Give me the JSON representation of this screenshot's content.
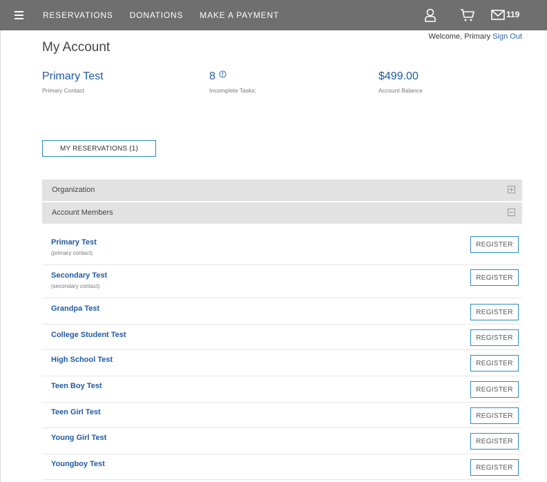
{
  "nav": {
    "items": [
      "RESERVATIONS",
      "DONATIONS",
      "MAKE A PAYMENT"
    ],
    "mail_count": "119",
    "icons": [
      "menu-icon",
      "user-icon",
      "cart-icon",
      "mail-icon"
    ]
  },
  "welcome": {
    "text": "Welcome, Primary",
    "sign_out": "Sign Out"
  },
  "page_title": "My Account",
  "stats": {
    "primary_name": "Primary Test",
    "primary_label": "Primary Contact",
    "tasks_value": "8",
    "tasks_label": "Incomplete Tasks:",
    "balance_value": "$499.00",
    "balance_label": "Account Balance"
  },
  "reservations_button": "MY RESERVATIONS (1)",
  "panels": {
    "organization": "Organization",
    "members": "Account Members"
  },
  "register_label": "REGISTER",
  "members": [
    {
      "name": "Primary Test",
      "role": "(primary contact)"
    },
    {
      "name": "Secondary Test",
      "role": "(secondary contact)"
    },
    {
      "name": "Grandpa Test",
      "role": ""
    },
    {
      "name": "College Student Test",
      "role": ""
    },
    {
      "name": "High School Test",
      "role": ""
    },
    {
      "name": "Teen Boy Test",
      "role": ""
    },
    {
      "name": "Teen Girl Test",
      "role": ""
    },
    {
      "name": "Young Girl Test",
      "role": ""
    },
    {
      "name": "Youngboy Test",
      "role": ""
    }
  ],
  "colors": {
    "topbar": "#6f6f6f",
    "link": "#1f5aa6",
    "accent_border": "#2a89c4",
    "panel": "#e2e2e2"
  }
}
